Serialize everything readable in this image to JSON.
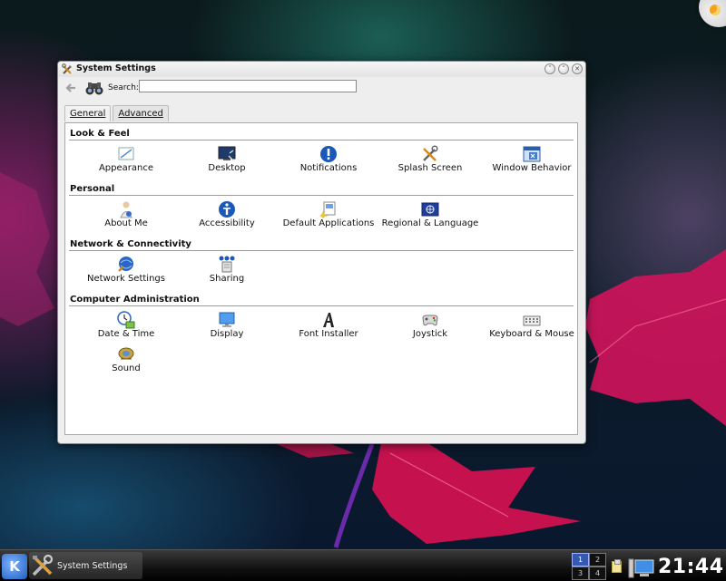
{
  "window": {
    "title": "System Settings",
    "controls": {
      "minimize": "˅",
      "maximize": "˄",
      "close": "✕"
    }
  },
  "toolbar": {
    "search_label": "Search:",
    "search_value": "",
    "search_placeholder": ""
  },
  "tabs": [
    {
      "label": "General",
      "active": true
    },
    {
      "label": "Advanced",
      "active": false
    }
  ],
  "sections": [
    {
      "title": "Look & Feel",
      "items": [
        {
          "label": "Appearance",
          "icon": "appearance-icon"
        },
        {
          "label": "Desktop",
          "icon": "desktop-icon"
        },
        {
          "label": "Notifications",
          "icon": "notifications-icon"
        },
        {
          "label": "Splash Screen",
          "icon": "splash-screen-icon"
        },
        {
          "label": "Window Behavior",
          "icon": "window-behavior-icon"
        }
      ]
    },
    {
      "title": "Personal",
      "items": [
        {
          "label": "About Me",
          "icon": "about-me-icon"
        },
        {
          "label": "Accessibility",
          "icon": "accessibility-icon"
        },
        {
          "label": "Default Applications",
          "icon": "default-applications-icon"
        },
        {
          "label": "Regional & Language",
          "icon": "regional-language-icon"
        }
      ]
    },
    {
      "title": "Network & Connectivity",
      "items": [
        {
          "label": "Network Settings",
          "icon": "network-settings-icon"
        },
        {
          "label": "Sharing",
          "icon": "sharing-icon"
        }
      ]
    },
    {
      "title": "Computer Administration",
      "items": [
        {
          "label": "Date & Time",
          "icon": "date-time-icon"
        },
        {
          "label": "Display",
          "icon": "display-icon"
        },
        {
          "label": "Font Installer",
          "icon": "font-installer-icon"
        },
        {
          "label": "Joystick",
          "icon": "joystick-icon"
        },
        {
          "label": "Keyboard & Mouse",
          "icon": "keyboard-mouse-icon"
        },
        {
          "label": "Sound",
          "icon": "sound-icon"
        }
      ]
    }
  ],
  "taskbar": {
    "task_label": "System Settings",
    "kde_glyph": "K",
    "desktops": [
      "1",
      "2",
      "3",
      "4"
    ],
    "active_desktop": "1",
    "clock": "21:44"
  }
}
